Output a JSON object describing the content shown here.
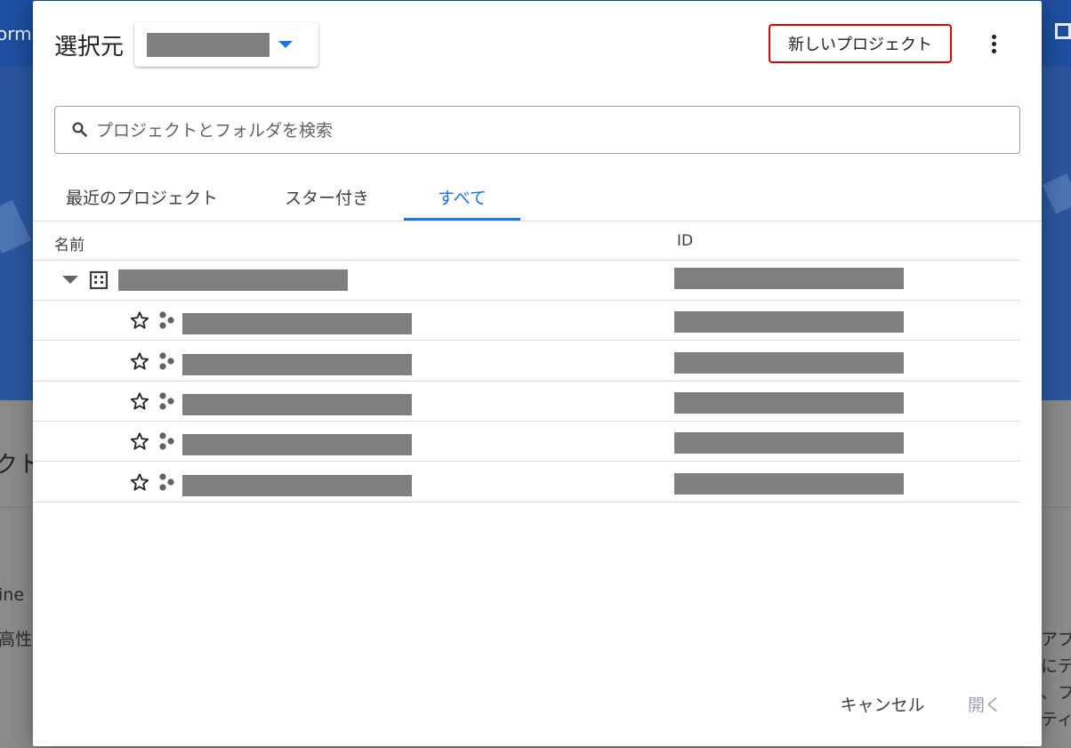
{
  "background": {
    "topbar_fragment": "orm",
    "section_fragment": "クト",
    "left_fragment_1": "ine",
    "left_fragment_2": "高性",
    "right_fragment_1": "アプ",
    "right_fragment_2": "にデ",
    "right_fragment_3": "、フ",
    "right_fragment_4": "ティ"
  },
  "dialog": {
    "title": "選択元",
    "new_project_label": "新しいプロジェクト",
    "search": {
      "placeholder": "プロジェクトとフォルダを検索",
      "value": ""
    },
    "tabs": [
      {
        "label": "最近のプロジェクト",
        "active": false
      },
      {
        "label": "スター付き",
        "active": false
      },
      {
        "label": "すべて",
        "active": true
      }
    ],
    "columns": {
      "name": "名前",
      "id": "ID"
    },
    "buttons": {
      "cancel": "キャンセル",
      "open": "開く"
    },
    "accent_color": "#1a73e8",
    "highlight_color": "#e00000"
  }
}
